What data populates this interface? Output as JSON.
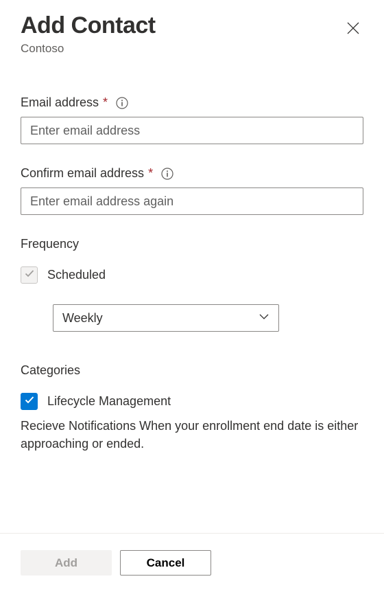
{
  "header": {
    "title": "Add Contact",
    "subtitle": "Contoso"
  },
  "fields": {
    "email": {
      "label": "Email address",
      "required_marker": "*",
      "placeholder": "Enter email address",
      "value": ""
    },
    "confirm_email": {
      "label": "Confirm email address",
      "required_marker": "*",
      "placeholder": "Enter email address again",
      "value": ""
    }
  },
  "frequency": {
    "label": "Frequency",
    "scheduled_label": "Scheduled",
    "scheduled_checked": true,
    "scheduled_disabled": true,
    "select_value": "Weekly"
  },
  "categories": {
    "label": "Categories",
    "lifecycle": {
      "label": "Lifecycle Management",
      "checked": true,
      "description": "Recieve Notifications When your enrollment end date is either approaching or ended."
    }
  },
  "footer": {
    "add_label": "Add",
    "cancel_label": "Cancel"
  }
}
